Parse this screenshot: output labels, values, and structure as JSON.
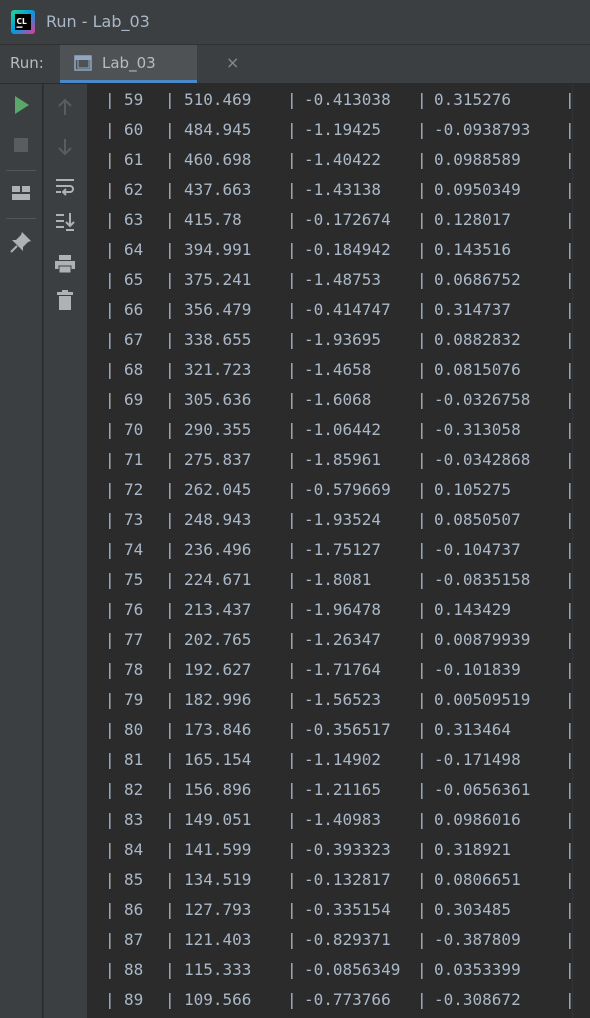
{
  "window": {
    "title": "Run - Lab_03",
    "logo_text": "CL"
  },
  "run_panel": {
    "label": "Run:",
    "tab_label": "Lab_03",
    "close_glyph": "×"
  },
  "toolbar": {
    "left_icons": [
      "run-icon",
      "stop-icon",
      "layout-icon",
      "pin-icon"
    ],
    "right_icons": [
      "up-arrow-icon",
      "down-arrow-icon",
      "soft-wrap-icon",
      "scroll-to-end-icon",
      "print-icon",
      "trash-icon"
    ]
  },
  "colors": {
    "run_green": "#59a869",
    "accent_blue": "#4a88c7",
    "text": "#a9b7c6"
  },
  "console": {
    "separator": "|",
    "rows": [
      [
        "59",
        "510.469",
        "-0.413038",
        "0.315276"
      ],
      [
        "60",
        "484.945",
        "-1.19425",
        "-0.0938793"
      ],
      [
        "61",
        "460.698",
        "-1.40422",
        "0.0988589"
      ],
      [
        "62",
        "437.663",
        "-1.43138",
        "0.0950349"
      ],
      [
        "63",
        "415.78",
        "-0.172674",
        "0.128017"
      ],
      [
        "64",
        "394.991",
        "-0.184942",
        "0.143516"
      ],
      [
        "65",
        "375.241",
        "-1.48753",
        "0.0686752"
      ],
      [
        "66",
        "356.479",
        "-0.414747",
        "0.314737"
      ],
      [
        "67",
        "338.655",
        "-1.93695",
        "0.0882832"
      ],
      [
        "68",
        "321.723",
        "-1.4658",
        "0.0815076"
      ],
      [
        "69",
        "305.636",
        "-1.6068",
        "-0.0326758"
      ],
      [
        "70",
        "290.355",
        "-1.06442",
        "-0.313058"
      ],
      [
        "71",
        "275.837",
        "-1.85961",
        "-0.0342868"
      ],
      [
        "72",
        "262.045",
        "-0.579669",
        "0.105275"
      ],
      [
        "73",
        "248.943",
        "-1.93524",
        "0.0850507"
      ],
      [
        "74",
        "236.496",
        "-1.75127",
        "-0.104737"
      ],
      [
        "75",
        "224.671",
        "-1.8081",
        "-0.0835158"
      ],
      [
        "76",
        "213.437",
        "-1.96478",
        "0.143429"
      ],
      [
        "77",
        "202.765",
        "-1.26347",
        "0.00879939"
      ],
      [
        "78",
        "192.627",
        "-1.71764",
        "-0.101839"
      ],
      [
        "79",
        "182.996",
        "-1.56523",
        "0.00509519"
      ],
      [
        "80",
        "173.846",
        "-0.356517",
        "0.313464"
      ],
      [
        "81",
        "165.154",
        "-1.14902",
        "-0.171498"
      ],
      [
        "82",
        "156.896",
        "-1.21165",
        "-0.0656361"
      ],
      [
        "83",
        "149.051",
        "-1.40983",
        "0.0986016"
      ],
      [
        "84",
        "141.599",
        "-0.393323",
        "0.318921"
      ],
      [
        "85",
        "134.519",
        "-0.132817",
        "0.0806651"
      ],
      [
        "86",
        "127.793",
        "-0.335154",
        "0.303485"
      ],
      [
        "87",
        "121.403",
        "-0.829371",
        "-0.387809"
      ],
      [
        "88",
        "115.333",
        "-0.0856349",
        "0.0353399"
      ],
      [
        "89",
        "109.566",
        "-0.773766",
        "-0.308672"
      ]
    ]
  }
}
